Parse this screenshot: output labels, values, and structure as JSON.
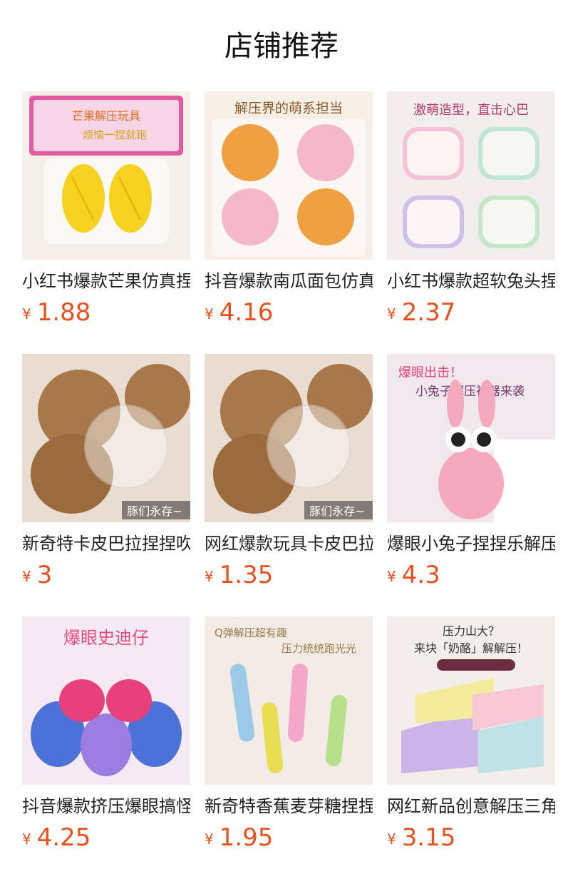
{
  "header": {
    "title": "店铺推荐"
  },
  "currency_symbol": "¥",
  "products": [
    {
      "name": "小红书爆款芒果仿真捏捏乐",
      "price": "1.88",
      "image_text": "芒果解压玩具 烦恼一捏就跑",
      "bg": "#f3efe9",
      "accent": "#f6d32a"
    },
    {
      "name": "抖音爆款南瓜面包仿真捏捏",
      "price": "4.16",
      "image_text": "解压界的萌系担当",
      "bg": "#f6efe6",
      "accent": "#f0a040"
    },
    {
      "name": "小红书爆款超软兔头捏捏乐",
      "price": "2.37",
      "image_text": "激萌造型，直击心巴",
      "bg": "#f2eeee",
      "accent": "#f6eef0"
    },
    {
      "name": "新奇特卡皮巴拉捏捏吹泡泡",
      "price": "3",
      "image_text": "豚们永存~",
      "bg": "#e9dcd0",
      "accent": "#9b6b3d"
    },
    {
      "name": "网红爆款玩具卡皮巴拉吹泡",
      "price": "1.35",
      "image_text": "豚们永存~",
      "bg": "#e9dcd0",
      "accent": "#9b6b3d"
    },
    {
      "name": "爆眼小兔子捏捏乐解压玩具",
      "price": "4.3",
      "image_text": "爆眼出击！小兔子解压神器来袭",
      "bg": "#f1e8ee",
      "accent": "#f5a9bf"
    },
    {
      "name": "抖音爆款挤压爆眼搞怪史迪仔",
      "price": "4.25",
      "image_text": "爆眼史迪仔",
      "bg": "#f5eaf3",
      "accent": "#4b72d6"
    },
    {
      "name": "新奇特香蕉麦芽糖捏捏乐",
      "price": "1.95",
      "image_text": "Q弹解压超有趣 压力统统跑光光",
      "bg": "#f3ece6",
      "accent": "#9cc9e6"
    },
    {
      "name": "网红新品创意解压三角奶酪",
      "price": "3.15",
      "image_text": "压力山大？来块「奶酪」解解压！",
      "bg": "#f3eee9",
      "accent": "#f4ec9c"
    }
  ]
}
